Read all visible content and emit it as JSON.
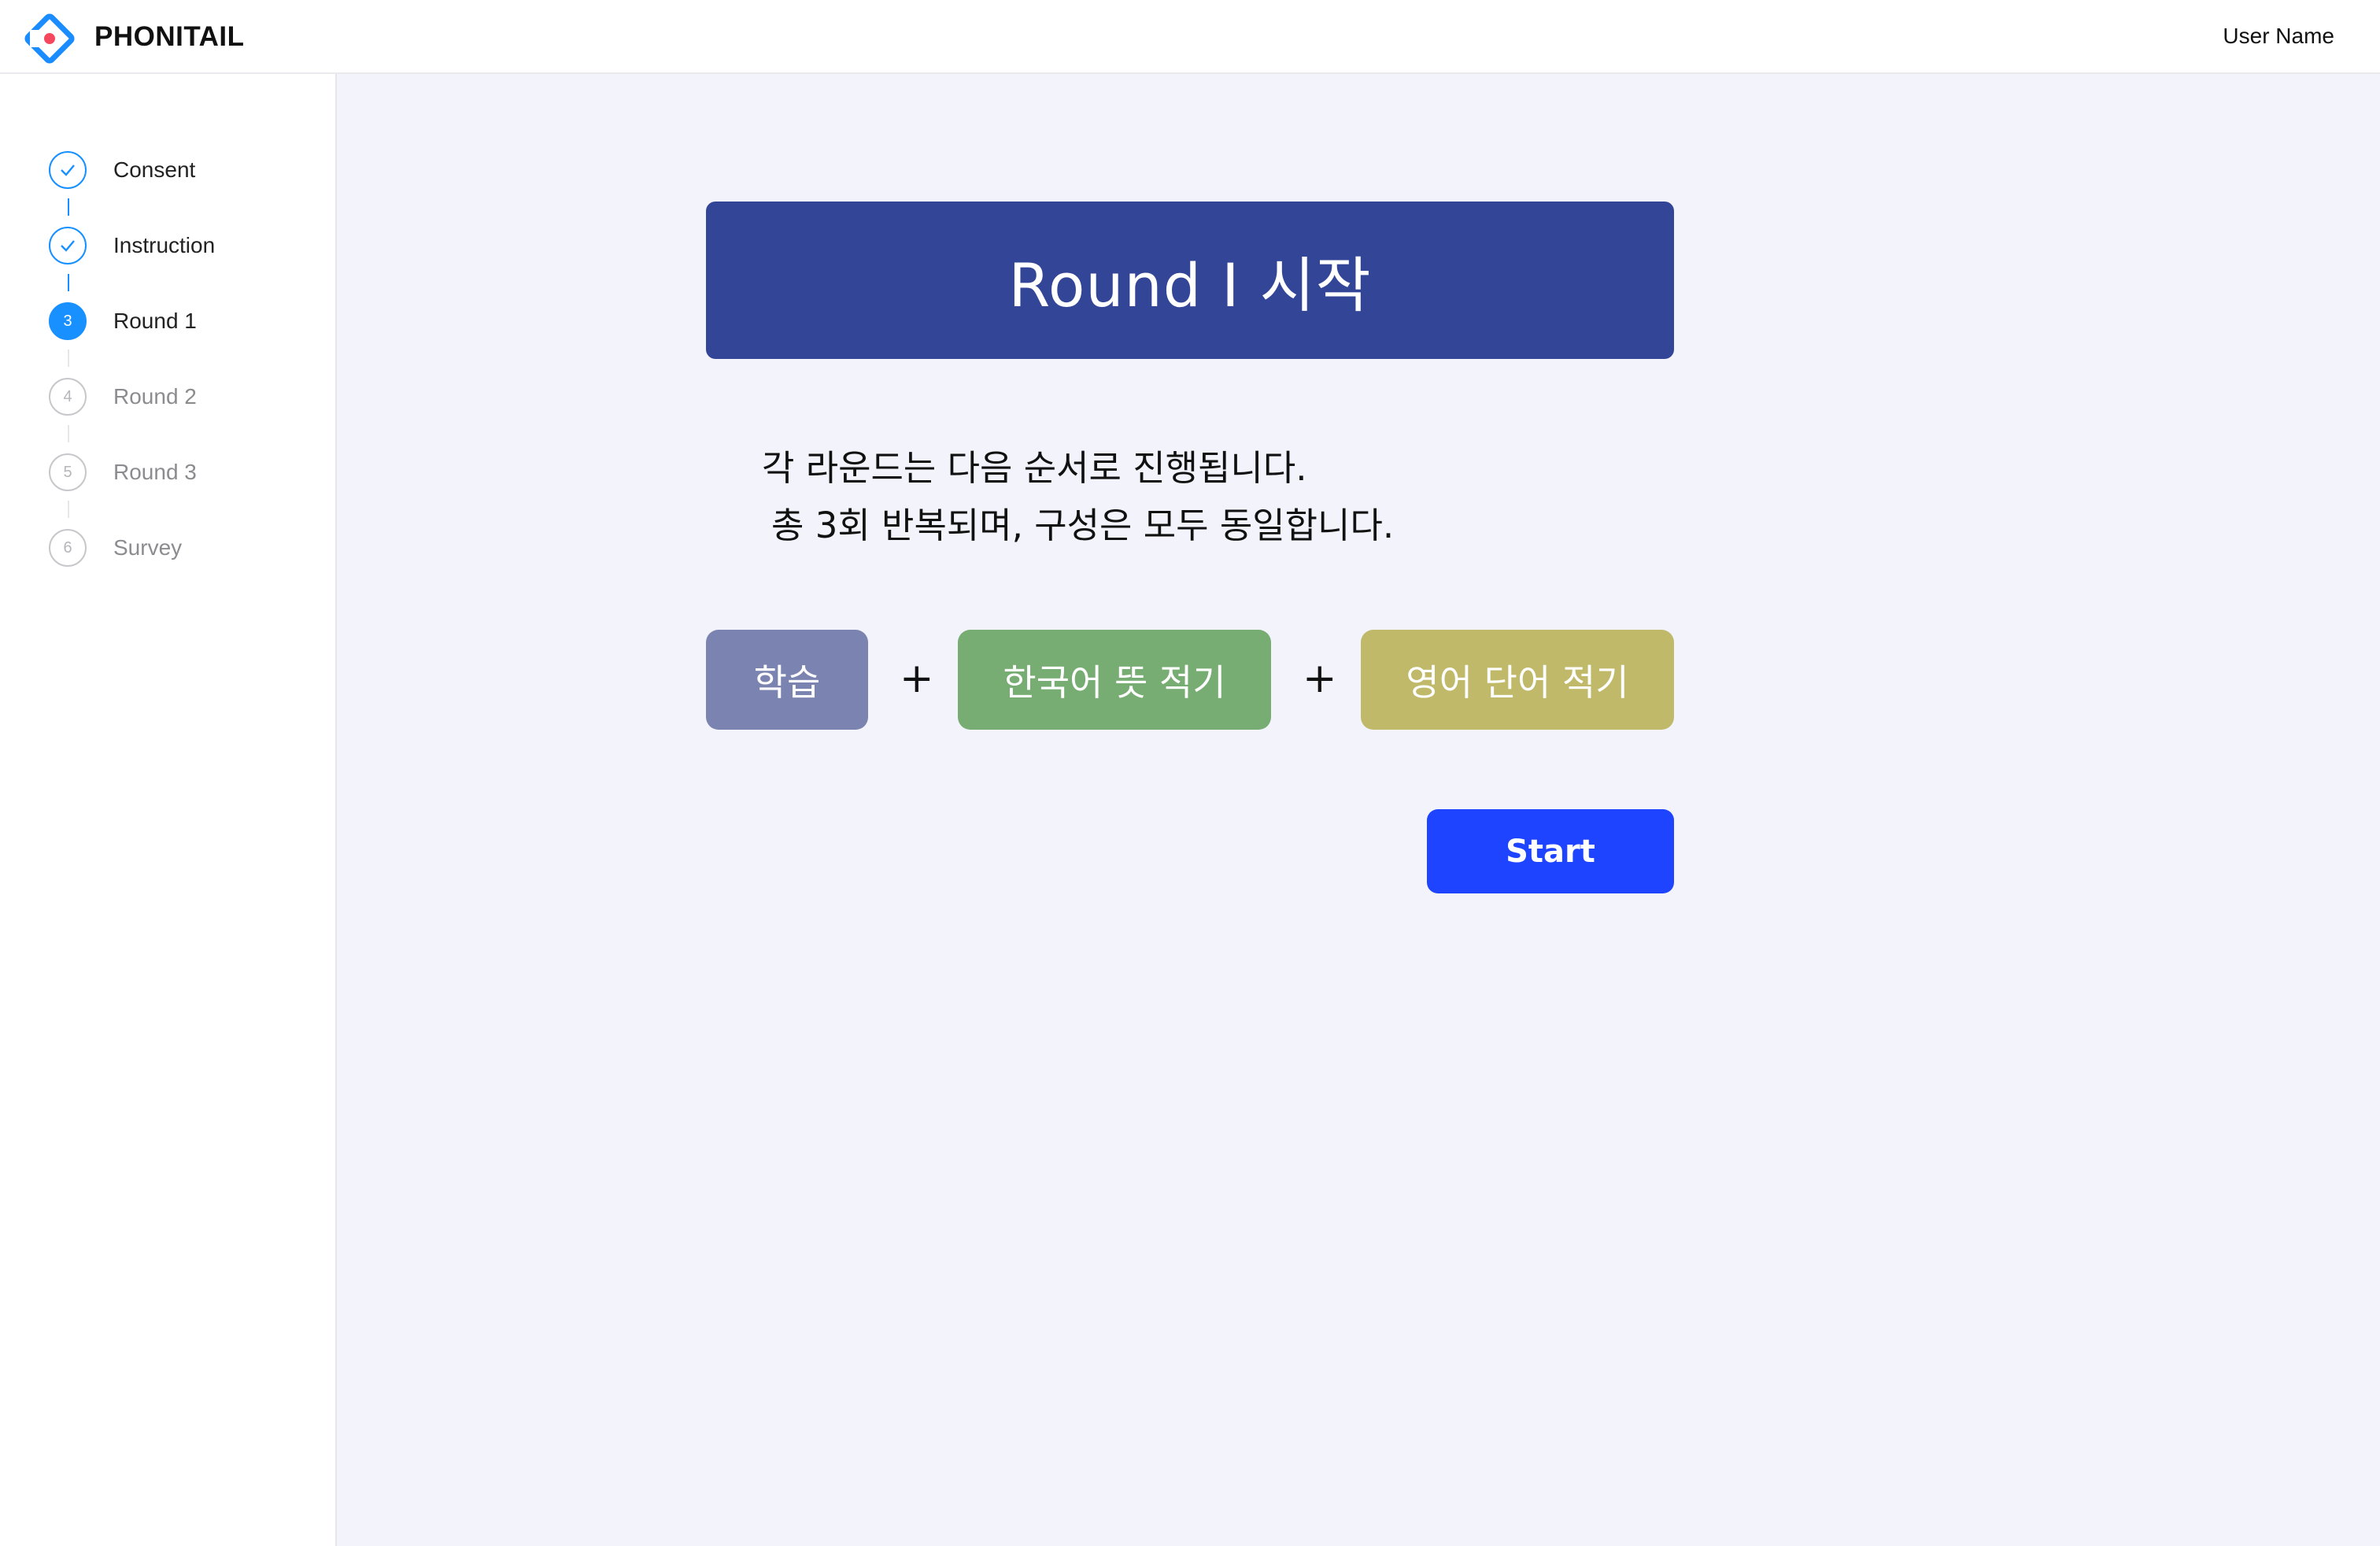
{
  "header": {
    "app_title": "PHONITAIL",
    "user_name": "User Name",
    "logo_icon": "phonitail-diamond-logo",
    "logo_colors": {
      "outer": "#1a8cff",
      "inner": "#f5475e"
    }
  },
  "sidebar": {
    "steps": [
      {
        "label": "Consent",
        "state": "done",
        "marker": ""
      },
      {
        "label": "Instruction",
        "state": "done",
        "marker": ""
      },
      {
        "label": "Round 1",
        "state": "active",
        "marker": "3"
      },
      {
        "label": "Round 2",
        "state": "pending",
        "marker": "4"
      },
      {
        "label": "Round 3",
        "state": "pending",
        "marker": "5"
      },
      {
        "label": "Survey",
        "state": "pending",
        "marker": "6"
      }
    ],
    "accent_color": "#1890ff"
  },
  "main": {
    "banner_title": "Round I 시작",
    "banner_color": "#334597",
    "description": {
      "line1": "각 라운드는 다음 순서로 진행됩니다.",
      "line2": "총 3회 반복되며, 구성은 모두 동일합니다."
    },
    "sequence": {
      "items": [
        {
          "label": "학습",
          "color": "#7b84b0"
        },
        {
          "label": "한국어 뜻 적기",
          "color": "#77ad72"
        },
        {
          "label": "영어 단어 적기",
          "color": "#c0b96a"
        }
      ],
      "separator": "+"
    },
    "start_button": {
      "label": "Start",
      "color": "#1f44ff"
    }
  }
}
